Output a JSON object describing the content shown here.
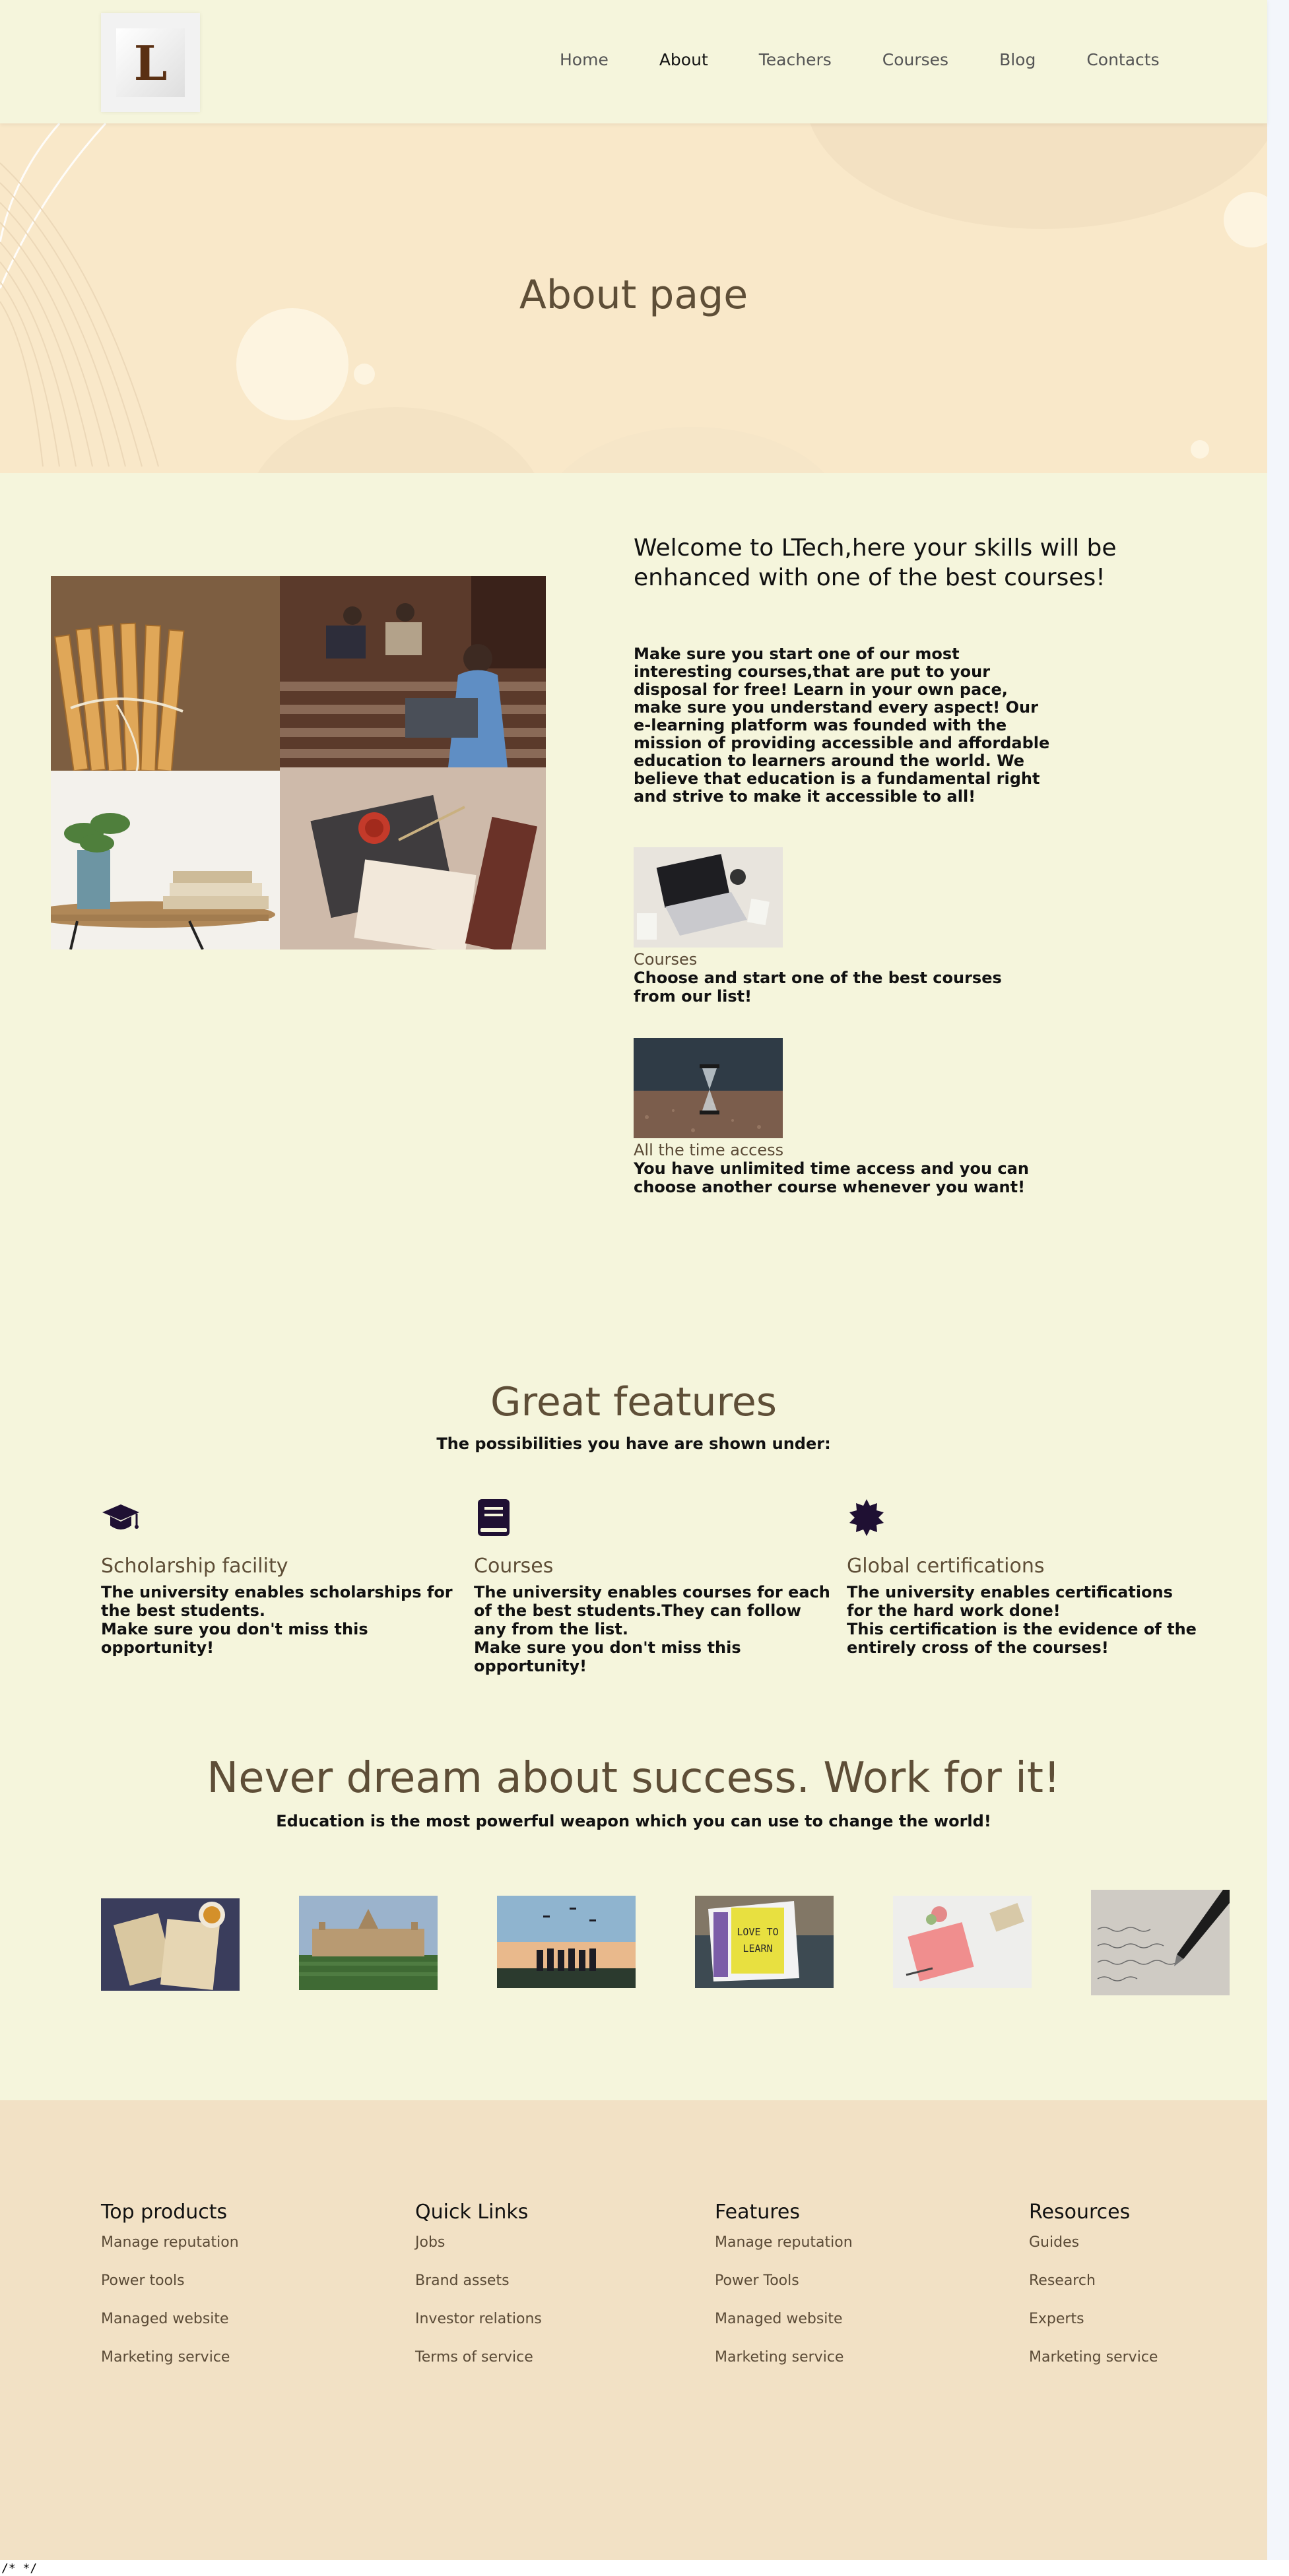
{
  "header": {
    "logo_letter": "L",
    "nav": [
      "Home",
      "About",
      "Teachers",
      "Courses",
      "Blog",
      "Contacts"
    ],
    "active": "About"
  },
  "hero": {
    "title": "About page"
  },
  "welcome": {
    "title": "Welcome to LTech,here your skills will be enhanced with one of the best courses!",
    "text": "Make sure you start one of our most interesting courses,that are put to your disposal for free! Learn in your own pace, make sure you understand every aspect! Our e-learning platform was founded with the mission of providing accessible and affordable education to learners around the world. We believe that education is a fundamental right and strive to make it accessible to all!",
    "cards": [
      {
        "label": "Courses",
        "text": "Choose and start one of the best courses from our list!"
      },
      {
        "label": "All the time access",
        "text": "You have unlimited time access and you can choose another course whenever you want!"
      }
    ]
  },
  "features": {
    "title": "Great features",
    "subtitle": "The possibilities you have are shown under:",
    "items": [
      {
        "icon": "graduation-cap-icon",
        "title": "Scholarship facility",
        "text": "The university enables scholarships for the best students.\nMake sure you don't miss this opportunity!"
      },
      {
        "icon": "book-icon",
        "title": "Courses",
        "text": "The university enables courses for each of the best students.They can follow any from the list.\nMake sure you don't miss this opportunity!"
      },
      {
        "icon": "certificate-icon",
        "title": "Global certifications",
        "text": "The university enables certifications for the hard work done!\nThis certification is the evidence of the entirely cross of the courses!"
      }
    ]
  },
  "quote": {
    "title": "Never dream about success. Work for it!",
    "subtitle": "Education is the most powerful weapon which you can use to change the world!",
    "sign_text": "LOVE TO LEARN"
  },
  "footer": {
    "columns": [
      {
        "title": "Top products",
        "links": [
          "Manage reputation",
          "Power tools",
          "Managed website",
          "Marketing service"
        ]
      },
      {
        "title": "Quick Links",
        "links": [
          "Jobs",
          "Brand assets",
          "Investor relations",
          "Terms of service"
        ]
      },
      {
        "title": "Features",
        "links": [
          "Manage reputation",
          "Power Tools",
          "Managed website",
          "Marketing service"
        ]
      },
      {
        "title": "Resources",
        "links": [
          "Guides",
          "Research",
          "Experts",
          "Marketing service"
        ]
      }
    ]
  },
  "page_comment": "/* */",
  "colors": {
    "background": "#f5f5dc",
    "hero": "#f9e8c9",
    "footer": "#f2e1c5",
    "heading_brown": "#5e4e37",
    "icon_navy": "#1f1033"
  }
}
